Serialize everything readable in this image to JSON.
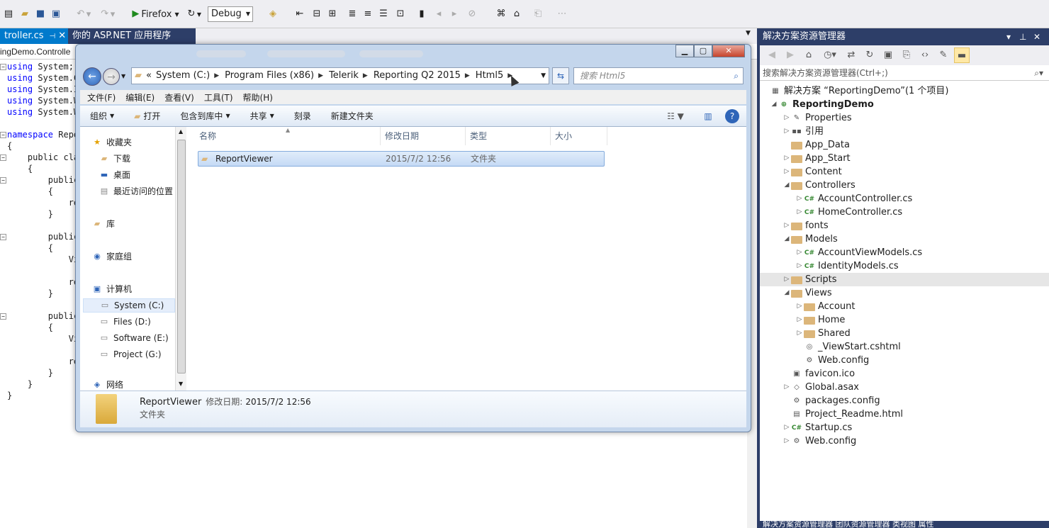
{
  "toolbar": {
    "browser_label": "Firefox",
    "config_value": "Debug"
  },
  "tabs": [
    {
      "label": "troller.cs"
    },
    {
      "label": "你的 ASP.NET 应用程序"
    }
  ],
  "editor": {
    "nav_text": "ingDemo.Controlle",
    "lines": [
      {
        "kw": "using",
        "rest": " System;"
      },
      {
        "kw": "using",
        "rest": " System.C"
      },
      {
        "kw": "using",
        "rest": " System.I"
      },
      {
        "kw": "using",
        "rest": " System.W"
      },
      {
        "kw": "using",
        "rest": " System.W"
      },
      {
        "kw": "",
        "rest": ""
      },
      {
        "kw": "namespace",
        "rest": " Repor"
      },
      {
        "kw": "",
        "rest": "{"
      },
      {
        "kw": "",
        "rest": "    public cla"
      },
      {
        "kw": "",
        "rest": "    {"
      },
      {
        "kw": "",
        "rest": "        public"
      },
      {
        "kw": "",
        "rest": "        {"
      },
      {
        "kw": "",
        "rest": "            re"
      },
      {
        "kw": "",
        "rest": "        }"
      },
      {
        "kw": "",
        "rest": ""
      },
      {
        "kw": "",
        "rest": "        public"
      },
      {
        "kw": "",
        "rest": "        {"
      },
      {
        "kw": "",
        "rest": "            Vi"
      },
      {
        "kw": "",
        "rest": ""
      },
      {
        "kw": "",
        "rest": "            re"
      },
      {
        "kw": "",
        "rest": "        }"
      },
      {
        "kw": "",
        "rest": ""
      },
      {
        "kw": "",
        "rest": "        public"
      },
      {
        "kw": "",
        "rest": "        {"
      },
      {
        "kw": "",
        "rest": "            Vi"
      },
      {
        "kw": "",
        "rest": ""
      },
      {
        "kw": "",
        "rest": "            re"
      },
      {
        "kw": "",
        "rest": "        }"
      },
      {
        "kw": "",
        "rest": "    }"
      },
      {
        "kw": "",
        "rest": "}"
      }
    ]
  },
  "explorer": {
    "address": {
      "prefix": "«",
      "crumbs": [
        "System (C:)",
        "Program Files (x86)",
        "Telerik",
        "Reporting Q2 2015",
        "Html5"
      ]
    },
    "search_placeholder": "搜索 Html5",
    "menu": [
      "文件(F)",
      "编辑(E)",
      "查看(V)",
      "工具(T)",
      "帮助(H)"
    ],
    "commands": {
      "organize": "组织",
      "open": "打开",
      "include": "包含到库中",
      "share": "共享",
      "burn": "刻录",
      "new_folder": "新建文件夹"
    },
    "nav": {
      "favorites": "收藏夹",
      "downloads": "下载",
      "desktop": "桌面",
      "recent": "最近访问的位置",
      "libraries": "库",
      "homegroup": "家庭组",
      "computer": "计算机",
      "drive_c": "System (C:)",
      "drive_d": "Files (D:)",
      "drive_e": "Software (E:)",
      "drive_g": "Project (G:)",
      "network": "网络"
    },
    "columns": {
      "name": "名称",
      "date": "修改日期",
      "type": "类型",
      "size": "大小"
    },
    "files": [
      {
        "name": "ReportViewer",
        "date": "2015/7/2 12:56",
        "type": "文件夹"
      }
    ],
    "details": {
      "name": "ReportViewer",
      "date_label": "修改日期:",
      "date": "2015/7/2 12:56",
      "type": "文件夹"
    }
  },
  "solution_explorer": {
    "title": "解决方案资源管理器",
    "search_placeholder": "搜索解决方案资源管理器(Ctrl+;)",
    "solution": "解决方案 “ReportingDemo”(1 个项目)",
    "project": "ReportingDemo",
    "items": [
      {
        "label": "Properties"
      },
      {
        "label": "引用"
      },
      {
        "label": "App_Data"
      },
      {
        "label": "App_Start"
      },
      {
        "label": "Content"
      },
      {
        "label": "Controllers"
      },
      {
        "label": "AccountController.cs"
      },
      {
        "label": "HomeController.cs"
      },
      {
        "label": "fonts"
      },
      {
        "label": "Models"
      },
      {
        "label": "AccountViewModels.cs"
      },
      {
        "label": "IdentityModels.cs"
      },
      {
        "label": "Scripts"
      },
      {
        "label": "Views"
      },
      {
        "label": "Account"
      },
      {
        "label": "Home"
      },
      {
        "label": "Shared"
      },
      {
        "label": "_ViewStart.cshtml"
      },
      {
        "label": "Web.config"
      },
      {
        "label": "favicon.ico"
      },
      {
        "label": "Global.asax"
      },
      {
        "label": "packages.config"
      },
      {
        "label": "Project_Readme.html"
      },
      {
        "label": "Startup.cs"
      },
      {
        "label": "Web.config"
      }
    ],
    "bottom_tabs": "解决方案资源管理器  团队资源管理器  类视图  属性"
  }
}
